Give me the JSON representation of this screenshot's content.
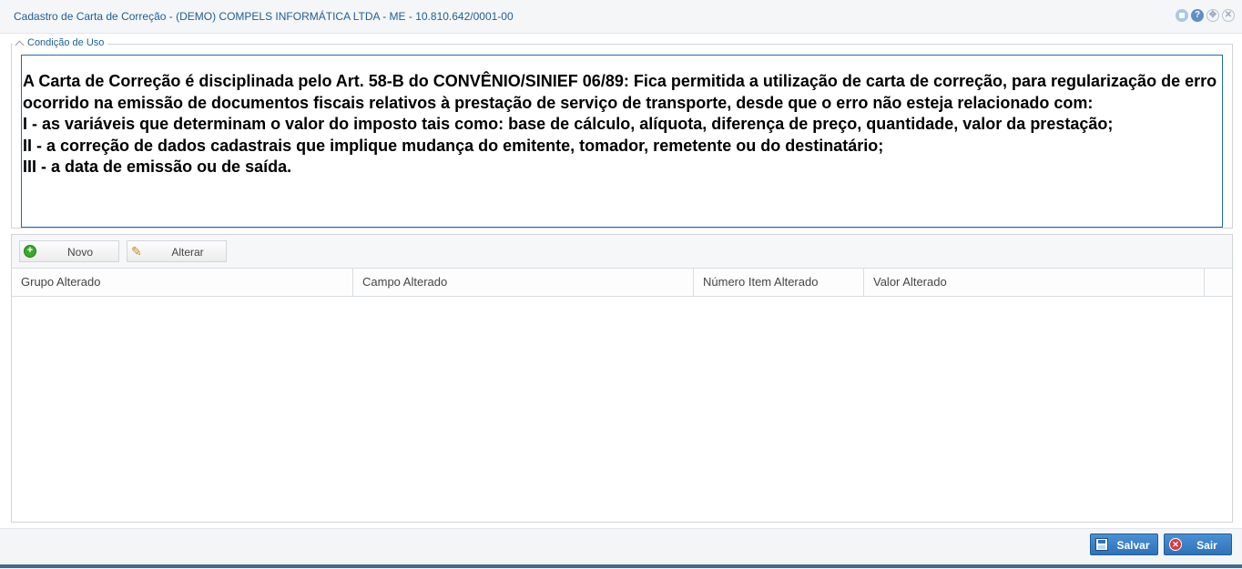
{
  "window": {
    "title": "Cadastro de Carta de Correção - (DEMO) COMPELS INFORMÁTICA LTDA - ME - 10.810.642/0001-00",
    "icons": [
      "minimize-icon",
      "help-icon",
      "move-icon",
      "close-icon"
    ],
    "help_glyph": "?",
    "move_glyph": "✥",
    "close_glyph": "✕"
  },
  "usage": {
    "legend": "Condição de Uso",
    "text": "A Carta de Correção é disciplinada pelo Art. 58-B do CONVÊNIO/SINIEF 06/89: Fica permitida a utilização de carta de correção, para regularização de erro ocorrido na emissão de documentos fiscais relativos à prestação de serviço de transporte, desde que o erro não esteja relacionado com:\nI - as variáveis que determinam o valor do imposto tais como: base de cálculo, alíquota, diferença de preço, quantidade, valor da prestação;\nII - a correção de dados cadastrais que implique mudança do emitente, tomador, remetente ou do destinatário;\nIII - a data de emissão ou de saída."
  },
  "toolbar": {
    "new_label": "Novo",
    "new_glyph": "+",
    "edit_label": "Alterar",
    "edit_glyph": "✎"
  },
  "grid": {
    "columns": [
      "Grupo Alterado",
      "Campo Alterado",
      "Número Item Alterado",
      "Valor Alterado"
    ],
    "rows": []
  },
  "footer": {
    "save_label": "Salvar",
    "exit_label": "Sair",
    "exit_glyph": "✕"
  },
  "colors": {
    "title": "#1f5e92",
    "textarea_border": "#1f6db3",
    "button_primary": "#2e73b8",
    "add_icon": "#3aa82c",
    "exit_icon": "#d93a3a"
  }
}
